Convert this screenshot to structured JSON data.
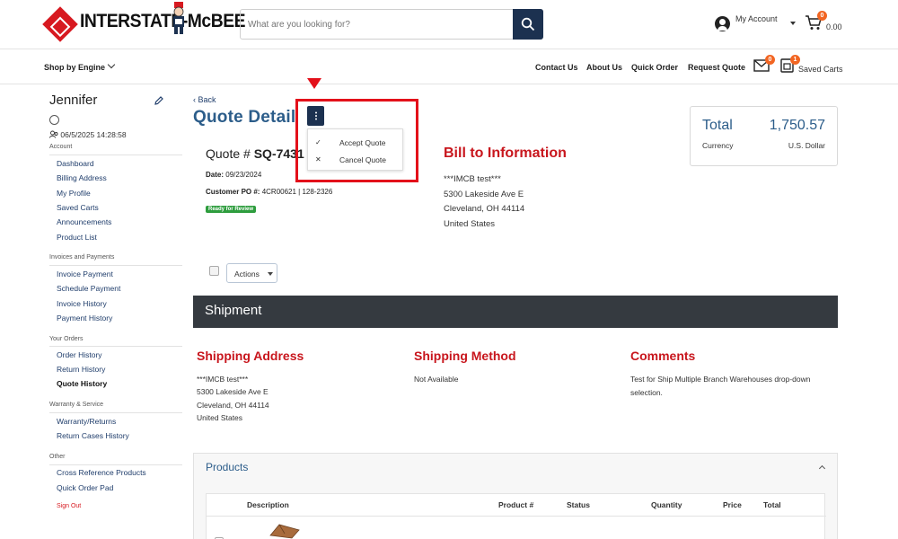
{
  "header": {
    "brand": "INTERSTATE-McBEE",
    "search_placeholder": "What are you looking for?",
    "my_account": "My Account",
    "cart_badge": "0",
    "cart_total": "0.00"
  },
  "nav": {
    "shop_by_engine": "Shop by Engine",
    "links": [
      "Contact Us",
      "About Us",
      "Quick Order",
      "Request Quote"
    ],
    "mail_badge": "0",
    "saved_badge": "1",
    "saved_carts": "Saved Carts"
  },
  "sidebar": {
    "user": "Jennifer",
    "session": "06/5/2025 14:28:58",
    "sections": [
      {
        "title": "Account",
        "items": [
          "Dashboard",
          "Billing Address",
          "My Profile",
          "Saved Carts",
          "Announcements",
          "Product List"
        ]
      },
      {
        "title": "Invoices and Payments",
        "items": [
          "Invoice Payment",
          "Schedule Payment",
          "Invoice History",
          "Payment History"
        ]
      },
      {
        "title": "Your Orders",
        "items": [
          "Order History",
          "Return History",
          "Quote History"
        ]
      },
      {
        "title": "Warranty & Service",
        "items": [
          "Warranty/Returns",
          "Return Cases History"
        ]
      },
      {
        "title": "Other",
        "items": [
          "Cross Reference Products",
          "Quick Order Pad"
        ]
      }
    ],
    "active_item": "Quote History",
    "sign_out": "Sign Out"
  },
  "quote": {
    "back": "Back",
    "title": "Quote Detail",
    "menu_items": [
      "Accept Quote",
      "Cancel Quote"
    ],
    "number_label": "Quote #",
    "number_value": "SQ-7431",
    "date_label": "Date:",
    "date_value": "09/23/2024",
    "po_label": "Customer PO #:",
    "po_value": "4CR00621 | 128-2326",
    "status": "Ready for Review",
    "actions": "Actions"
  },
  "bill_to": {
    "title": "Bill to Information",
    "lines": [
      "***IMCB test***",
      "5300 Lakeside Ave E",
      "Cleveland, OH 44114",
      "United States"
    ]
  },
  "totals": {
    "total_label": "Total",
    "total_value": "1,750.57",
    "currency_label": "Currency",
    "currency_value": "U.S. Dollar"
  },
  "shipment": {
    "title": "Shipment",
    "address_title": "Shipping Address",
    "address_lines": [
      "***IMCB test***",
      "5300 Lakeside Ave E",
      "Cleveland, OH 44114",
      "United States"
    ],
    "method_title": "Shipping Method",
    "method_value": "Not Available",
    "comments_title": "Comments",
    "comments_lines": [
      "Test for Ship Multiple Branch Warehouses drop-down",
      "selection."
    ]
  },
  "products": {
    "title": "Products",
    "columns": [
      "Description",
      "Product #",
      "Status",
      "Quantity",
      "Price",
      "Total"
    ]
  },
  "colors": {
    "brand_red": "#d71920",
    "navy": "#1c3150",
    "title_blue": "#2c5d8a",
    "heading_red": "#c8161d",
    "shipment_bar": "#353a40",
    "highlight": "#e3101a"
  }
}
